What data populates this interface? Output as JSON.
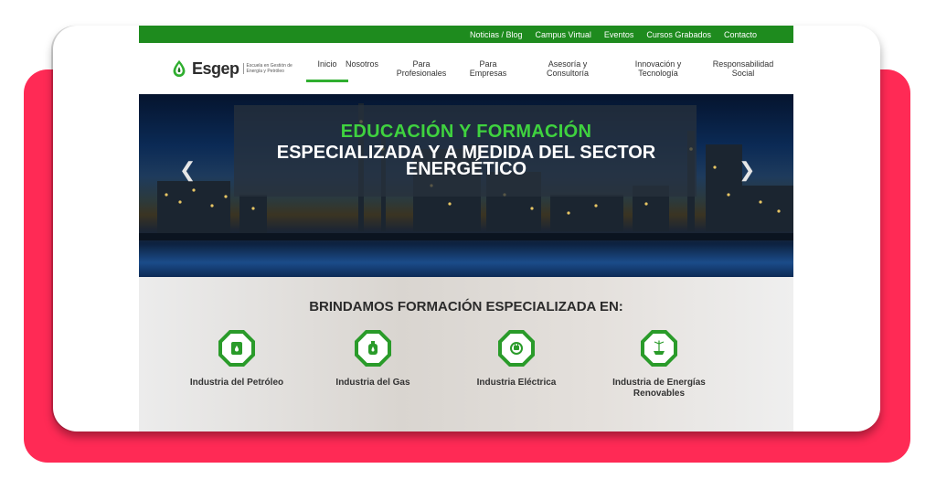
{
  "topbar": {
    "links": [
      "Noticias / Blog",
      "Campus Virtual",
      "Eventos",
      "Cursos Grabados",
      "Contacto"
    ]
  },
  "logo": {
    "name": "Esgep",
    "subtitle": "Escuela en Gestión de Energía y Petróleo"
  },
  "menu": {
    "items": [
      {
        "label": "Inicio"
      },
      {
        "label": "Nosotros"
      },
      {
        "label": "Para Profesionales"
      },
      {
        "label": "Para Empresas"
      },
      {
        "label": "Asesoría y Consultoría"
      },
      {
        "label": "Innovación y Tecnología"
      },
      {
        "label": "Responsabilidad Social"
      }
    ],
    "active": "Inicio"
  },
  "hero": {
    "line1": "EDUCACIÓN Y FORMACIÓN",
    "line2": "ESPECIALIZADA Y A MEDIDA DEL SECTOR ENERGÉTICO"
  },
  "section": {
    "title": "BRINDAMOS FORMACIÓN ESPECIALIZADA EN:",
    "features": [
      {
        "label": "Industria del Petróleo",
        "icon": "oil-barrel-icon"
      },
      {
        "label": "Industria del Gas",
        "icon": "gas-cylinder-icon"
      },
      {
        "label": "Industria Eléctrica",
        "icon": "electric-plug-icon"
      },
      {
        "label": "Industria de Energías Renovables",
        "icon": "solar-panel-icon"
      }
    ]
  },
  "colors": {
    "brand_green": "#1e8b1e",
    "accent_green": "#3fd23f",
    "frame_pink": "#ff2a55"
  }
}
